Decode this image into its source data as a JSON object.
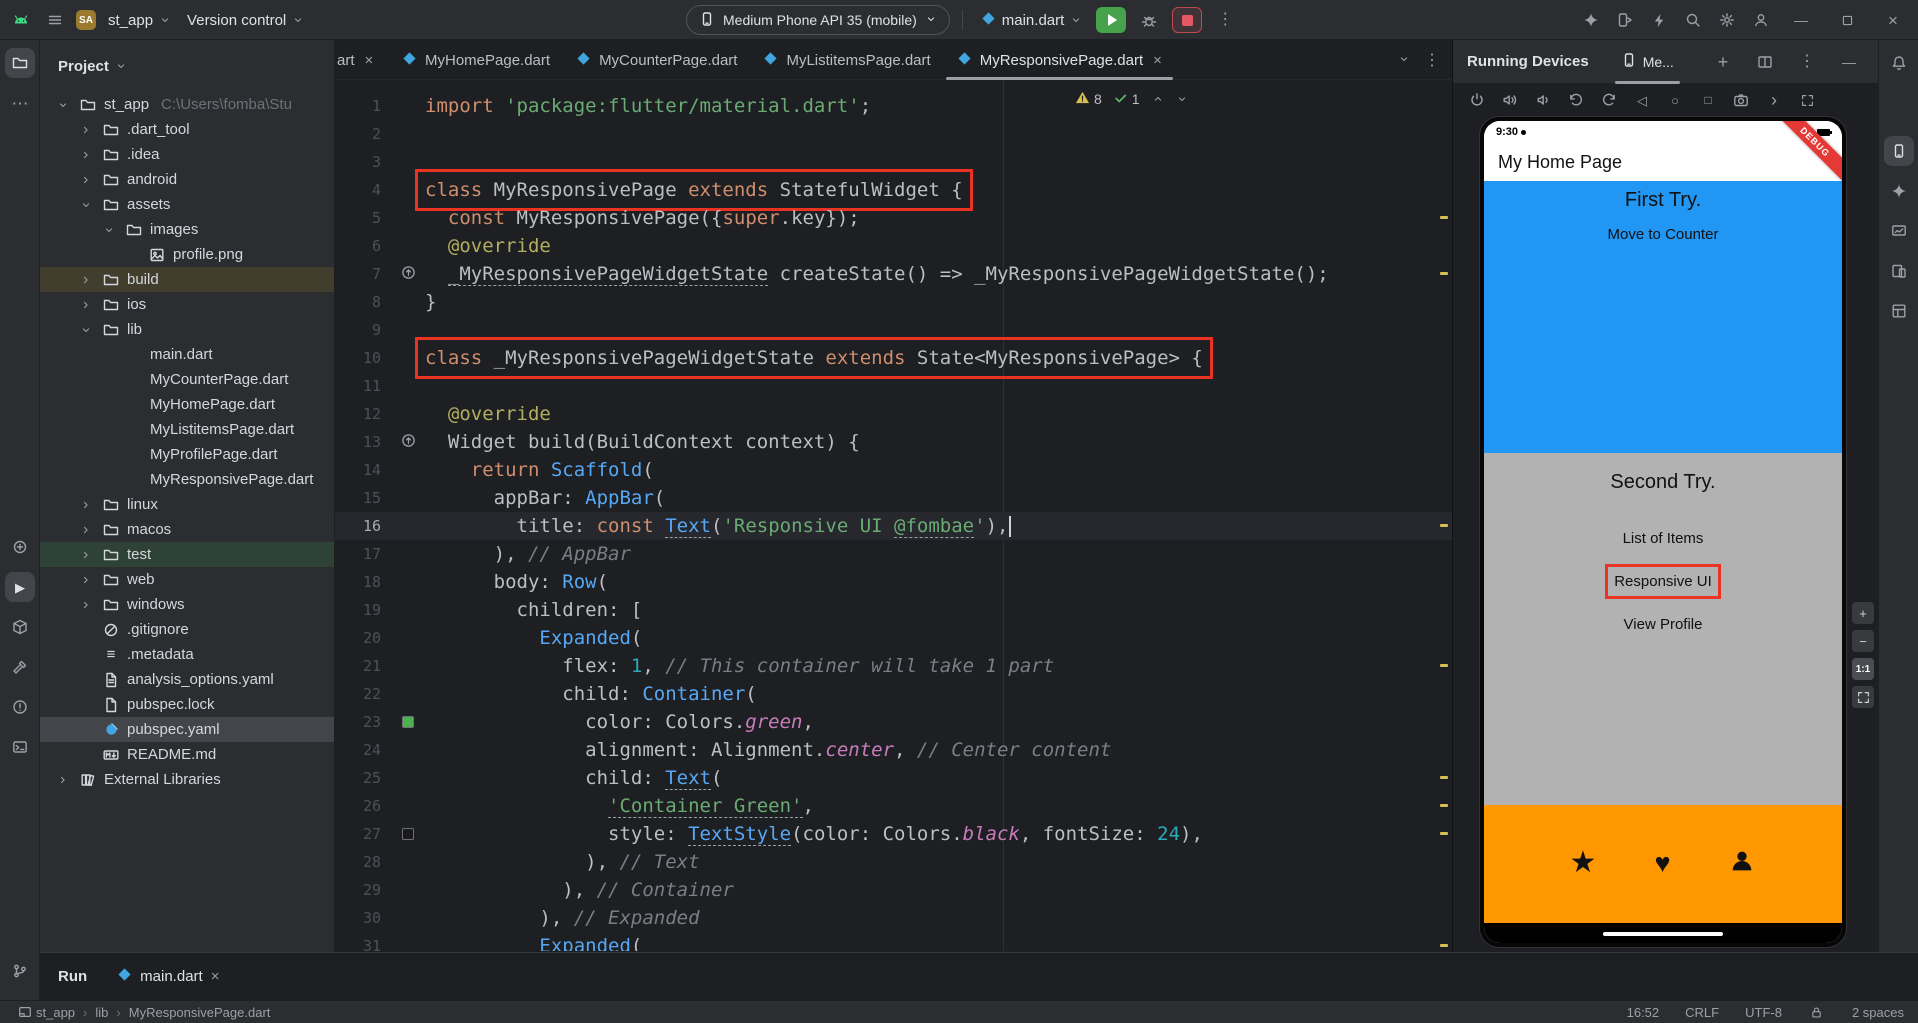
{
  "theme": {
    "accent_red": "#ea3323",
    "selection_gray": "#43454a"
  },
  "titlebar": {
    "badge": "SA",
    "project": "st_app",
    "vcs": "Version control",
    "device": "Medium Phone API 35 (mobile)",
    "config": "main.dart"
  },
  "left_strip": {
    "top": [
      {
        "name": "project",
        "icon": "project-folder",
        "active": true
      },
      {
        "name": "more-tools",
        "icon": "more"
      }
    ],
    "middle": [
      {
        "name": "logcat",
        "icon": "logcat"
      },
      {
        "name": "run",
        "icon": "run-play",
        "active": true
      },
      {
        "name": "packages",
        "icon": "packages"
      },
      {
        "name": "build",
        "icon": "build"
      },
      {
        "name": "problems",
        "icon": "problems"
      },
      {
        "name": "terminal",
        "icon": "terminal"
      }
    ],
    "bottom": [
      {
        "name": "version-control",
        "icon": "git"
      }
    ]
  },
  "right_strip": {
    "top": [
      {
        "name": "notifications",
        "icon": "bell"
      }
    ],
    "middle": [
      {
        "name": "running-devices",
        "icon": "running-devices",
        "active": true
      },
      {
        "name": "gemini",
        "icon": "gemini"
      },
      {
        "name": "app-quality-insights",
        "icon": "insights"
      },
      {
        "name": "device-manager",
        "icon": "device-manager"
      },
      {
        "name": "layout-inspector",
        "icon": "layout-inspector"
      }
    ],
    "bottom": []
  },
  "project_panel": {
    "title": "Project",
    "tree": [
      {
        "label": "st_app",
        "path": "C:\\Users\\fomba\\Stu",
        "indent": 0,
        "icon": "folder",
        "chev": "open",
        "root": true
      },
      {
        "label": ".dart_tool",
        "indent": 1,
        "icon": "folder",
        "chev": "closed"
      },
      {
        "label": ".idea",
        "indent": 1,
        "icon": "folder",
        "chev": "closed"
      },
      {
        "label": "android",
        "indent": 1,
        "icon": "folder",
        "chev": "closed"
      },
      {
        "label": "assets",
        "indent": 1,
        "icon": "folder",
        "chev": "open"
      },
      {
        "label": "images",
        "indent": 2,
        "icon": "folder",
        "chev": "open"
      },
      {
        "label": "profile.png",
        "indent": 3,
        "icon": "image",
        "chev": "none"
      },
      {
        "label": "build",
        "indent": 1,
        "icon": "folder",
        "chev": "closed",
        "bg": "olive"
      },
      {
        "label": "ios",
        "indent": 1,
        "icon": "folder",
        "chev": "closed"
      },
      {
        "label": "lib",
        "indent": 1,
        "icon": "folder",
        "chev": "open"
      },
      {
        "label": "main.dart",
        "indent": 2,
        "icon": "dart",
        "chev": "none"
      },
      {
        "label": "MyCounterPage.dart",
        "indent": 2,
        "icon": "dart",
        "chev": "none"
      },
      {
        "label": "MyHomePage.dart",
        "indent": 2,
        "icon": "dart",
        "chev": "none"
      },
      {
        "label": "MyListitemsPage.dart",
        "indent": 2,
        "icon": "dart",
        "chev": "none"
      },
      {
        "label": "MyProfilePage.dart",
        "indent": 2,
        "icon": "dart",
        "chev": "none"
      },
      {
        "label": "MyResponsivePage.dart",
        "indent": 2,
        "icon": "dart",
        "chev": "none"
      },
      {
        "label": "linux",
        "indent": 1,
        "icon": "folder",
        "chev": "closed"
      },
      {
        "label": "macos",
        "indent": 1,
        "icon": "folder",
        "chev": "closed"
      },
      {
        "label": "test",
        "indent": 1,
        "icon": "folder",
        "chev": "closed",
        "bg": "green"
      },
      {
        "label": "web",
        "indent": 1,
        "icon": "folder",
        "chev": "closed"
      },
      {
        "label": "windows",
        "indent": 1,
        "icon": "folder",
        "chev": "closed"
      },
      {
        "label": ".gitignore",
        "indent": 1,
        "icon": "ignore",
        "chev": "none"
      },
      {
        "label": ".metadata",
        "indent": 1,
        "icon": "meta",
        "chev": "none"
      },
      {
        "label": "analysis_options.yaml",
        "indent": 1,
        "icon": "yaml",
        "chev": "none"
      },
      {
        "label": "pubspec.lock",
        "indent": 1,
        "icon": "file",
        "chev": "none"
      },
      {
        "label": "pubspec.yaml",
        "indent": 1,
        "icon": "pub",
        "chev": "none",
        "bg": "selected"
      },
      {
        "label": "README.md",
        "indent": 1,
        "icon": "md",
        "chev": "none"
      },
      {
        "label": "External Libraries",
        "indent": 0,
        "icon": "lib",
        "chev": "closed"
      }
    ]
  },
  "editor_tabs": {
    "tabs": [
      {
        "label": "art",
        "close": true,
        "partial": true
      },
      {
        "label": "MyHomePage.dart"
      },
      {
        "label": "MyCounterPage.dart"
      },
      {
        "label": "MyListitemsPage.dart"
      },
      {
        "label": "MyResponsivePage.dart",
        "active": true,
        "close": true
      }
    ]
  },
  "editor": {
    "warning_count": "8",
    "ok_count": "1",
    "lines": [
      {
        "n": 1,
        "tokens": [
          [
            "import ",
            "k"
          ],
          [
            "'package:flutter/material.dart'",
            "s"
          ],
          [
            ";",
            "d"
          ]
        ]
      },
      {
        "n": 2,
        "tokens": []
      },
      {
        "n": 3,
        "tokens": []
      },
      {
        "n": 4,
        "box": true,
        "tokens": [
          [
            "class ",
            "k"
          ],
          [
            "MyResponsivePage ",
            "d"
          ],
          [
            "extends ",
            "k"
          ],
          [
            "StatefulWidget {",
            "d"
          ]
        ]
      },
      {
        "n": 5,
        "tokens": [
          [
            "  ",
            "d"
          ],
          [
            "const ",
            "k"
          ],
          [
            "MyResponsivePage({",
            "d"
          ],
          [
            "super",
            "k"
          ],
          [
            ".key});",
            "d"
          ]
        ]
      },
      {
        "n": 6,
        "tokens": [
          [
            "  ",
            "d"
          ],
          [
            "@override",
            "a"
          ]
        ]
      },
      {
        "n": 7,
        "gutter": "override",
        "tokens": [
          [
            "  ",
            "d"
          ],
          [
            "_MyResponsivePageWidgetState",
            "d u"
          ],
          [
            " createState() => _MyResponsivePageWidgetState();",
            "d"
          ]
        ]
      },
      {
        "n": 8,
        "tokens": [
          [
            "}",
            "d"
          ]
        ]
      },
      {
        "n": 9,
        "tokens": []
      },
      {
        "n": 10,
        "box": true,
        "tokens": [
          [
            "class ",
            "k"
          ],
          [
            "_MyResponsivePageWidgetState ",
            "d"
          ],
          [
            "extends ",
            "k"
          ],
          [
            "State<MyResponsivePage> {",
            "d"
          ]
        ]
      },
      {
        "n": 11,
        "tokens": []
      },
      {
        "n": 12,
        "tokens": [
          [
            "  ",
            "d"
          ],
          [
            "@override",
            "a"
          ]
        ]
      },
      {
        "n": 13,
        "gutter": "override",
        "tokens": [
          [
            "  Widget build(BuildContext context) {",
            "d"
          ]
        ]
      },
      {
        "n": 14,
        "tokens": [
          [
            "    ",
            "d"
          ],
          [
            "return ",
            "k"
          ],
          [
            "Scaffold",
            "w"
          ],
          [
            "(",
            "d"
          ]
        ]
      },
      {
        "n": 15,
        "tokens": [
          [
            "      appBar: ",
            "d"
          ],
          [
            "AppBar",
            "w"
          ],
          [
            "(",
            "d"
          ]
        ]
      },
      {
        "n": 16,
        "current": true,
        "tokens": [
          [
            "        title: ",
            "d"
          ],
          [
            "const ",
            "k"
          ],
          [
            "Text",
            "w u"
          ],
          [
            "(",
            "d"
          ],
          [
            "'Responsive UI ",
            "s"
          ],
          [
            "@fombae",
            "s u"
          ],
          [
            "'",
            "s"
          ],
          [
            "),",
            "d"
          ]
        ]
      },
      {
        "n": 17,
        "tokens": [
          [
            "      ), ",
            "d"
          ],
          [
            "// AppBar",
            "c"
          ]
        ]
      },
      {
        "n": 18,
        "tokens": [
          [
            "      body: ",
            "d"
          ],
          [
            "Row",
            "w"
          ],
          [
            "(",
            "d"
          ]
        ]
      },
      {
        "n": 19,
        "tokens": [
          [
            "        children: [",
            "d"
          ]
        ]
      },
      {
        "n": 20,
        "tokens": [
          [
            "          ",
            "d"
          ],
          [
            "Expanded",
            "w"
          ],
          [
            "(",
            "d"
          ]
        ]
      },
      {
        "n": 21,
        "tokens": [
          [
            "            flex: ",
            "d"
          ],
          [
            "1",
            "n"
          ],
          [
            ", ",
            "d"
          ],
          [
            "// This container will take 1 part",
            "c"
          ]
        ]
      },
      {
        "n": 22,
        "tokens": [
          [
            "            child: ",
            "d"
          ],
          [
            "Container",
            "w"
          ],
          [
            "(",
            "d"
          ]
        ]
      },
      {
        "n": 23,
        "gutter": "green",
        "tokens": [
          [
            "              color: Colors.",
            "d"
          ],
          [
            "green",
            "m"
          ],
          [
            ",",
            "d"
          ]
        ]
      },
      {
        "n": 24,
        "tokens": [
          [
            "              alignment: Alignment.",
            "d"
          ],
          [
            "center",
            "m"
          ],
          [
            ", ",
            "d"
          ],
          [
            "// Center content",
            "c"
          ]
        ]
      },
      {
        "n": 25,
        "tokens": [
          [
            "              child: ",
            "d"
          ],
          [
            "Text",
            "w u"
          ],
          [
            "(",
            "d"
          ]
        ]
      },
      {
        "n": 26,
        "tokens": [
          [
            "                ",
            "d"
          ],
          [
            "'Container Green'",
            "s u"
          ],
          [
            ",",
            "d"
          ]
        ]
      },
      {
        "n": 27,
        "gutter": "black",
        "tokens": [
          [
            "                style: ",
            "d"
          ],
          [
            "TextStyle",
            "w u"
          ],
          [
            "(color: Colors.",
            "d"
          ],
          [
            "black",
            "m"
          ],
          [
            ", fontSize: ",
            "d"
          ],
          [
            "24",
            "n"
          ],
          [
            "),",
            "d"
          ]
        ]
      },
      {
        "n": 28,
        "tokens": [
          [
            "              ), ",
            "d"
          ],
          [
            "// Text",
            "c"
          ]
        ]
      },
      {
        "n": 29,
        "tokens": [
          [
            "            ), ",
            "d"
          ],
          [
            "// Container",
            "c"
          ]
        ]
      },
      {
        "n": 30,
        "tokens": [
          [
            "          ), ",
            "d"
          ],
          [
            "// Expanded",
            "c"
          ]
        ]
      },
      {
        "n": 31,
        "tokens": [
          [
            "          ",
            "d"
          ],
          [
            "Expanded",
            "w u"
          ],
          [
            "(",
            "d"
          ]
        ]
      }
    ]
  },
  "devices_panel": {
    "title": "Running Devices",
    "tab": "Me...",
    "toolbar": [
      "power",
      "volume-up",
      "volume-down",
      "rotate-left",
      "rotate-right",
      "back",
      "home",
      "overview",
      "screenshot",
      "more-chevron",
      "fullscreen"
    ],
    "zoom": {
      "zoom_in": "+",
      "zoom_out": "−",
      "actual": "1:1"
    },
    "phone": {
      "time": "9:30",
      "app_title": "My Home Page",
      "debug_banner": "DEBUG",
      "blue_section": {
        "title": "First Try.",
        "subtitle": "Move to Counter",
        "color": "#2196f3"
      },
      "gray_section": {
        "title": "Second Try.",
        "items": [
          "List of Items",
          "Responsive UI",
          "View Profile"
        ],
        "highlighted_item": "Responsive UI",
        "color": "#b2b2b2"
      },
      "orange_section": {
        "icons": [
          "star",
          "heart",
          "person"
        ],
        "color": "#ff9800"
      }
    }
  },
  "run_bar": {
    "title": "Run",
    "tab": "main.dart"
  },
  "status_bar": {
    "crumbs": [
      "st_app",
      "lib",
      "MyResponsivePage.dart"
    ],
    "cursor": "16:52",
    "line_ending": "CRLF",
    "encoding": "UTF-8",
    "indent": "2 spaces"
  }
}
